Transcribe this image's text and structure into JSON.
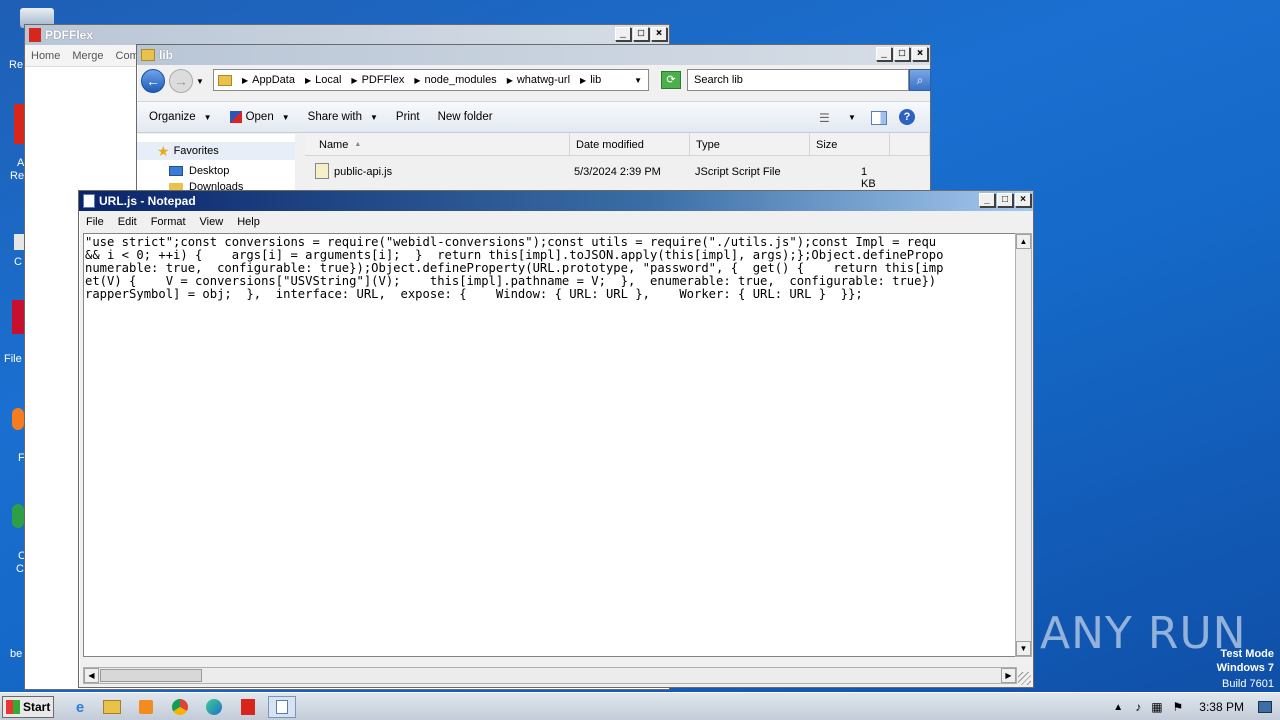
{
  "desktop": {
    "labels": [
      "Re",
      "A",
      "Re",
      "C",
      "File",
      "F",
      "C",
      "C",
      "be"
    ]
  },
  "pdfflex": {
    "title": "PDFFlex",
    "menu": [
      "Home",
      "Merge",
      "Com"
    ]
  },
  "explorer": {
    "title": "lib",
    "breadcrumbs": [
      "AppData",
      "Local",
      "PDFFlex",
      "node_modules",
      "whatwg-url",
      "lib"
    ],
    "search_placeholder": "Search lib",
    "commands": {
      "organize": "Organize",
      "open": "Open",
      "share_with": "Share with",
      "print": "Print",
      "new_folder": "New folder"
    },
    "nav": {
      "favorites": "Favorites",
      "desktop": "Desktop",
      "downloads": "Downloads"
    },
    "columns": [
      "Name",
      "Date modified",
      "Type",
      "Size"
    ],
    "files": [
      {
        "name": "public-api.js",
        "date": "5/3/2024 2:39 PM",
        "type": "JScript Script File",
        "size": "1 KB"
      }
    ]
  },
  "notepad": {
    "title": "URL.js - Notepad",
    "menu": [
      "File",
      "Edit",
      "Format",
      "View",
      "Help"
    ],
    "lines": [
      "\"use strict\";const conversions = require(\"webidl-conversions\");const utils = require(\"./utils.js\");const Impl = requ",
      "&& i < 0; ++i) {    args[i] = arguments[i];  }  return this[impl].toJSON.apply(this[impl], args);};Object.definePropo",
      "numerable: true,  configurable: true});Object.defineProperty(URL.prototype, \"password\", {  get() {    return this[imp",
      "et(V) {    V = conversions[\"USVString\"](V);    this[impl].pathname = V;  },  enumerable: true,  configurable: true})",
      "rapperSymbol] = obj;  },  interface: URL,  expose: {    Window: { URL: URL },    Worker: { URL: URL }  }};"
    ]
  },
  "taskbar": {
    "start_label": "Start",
    "time": "3:38 PM"
  },
  "watermark": {
    "text": "ANY RUN",
    "test_mode": "Test Mode",
    "os": "Windows 7",
    "build": "Build 7601"
  }
}
